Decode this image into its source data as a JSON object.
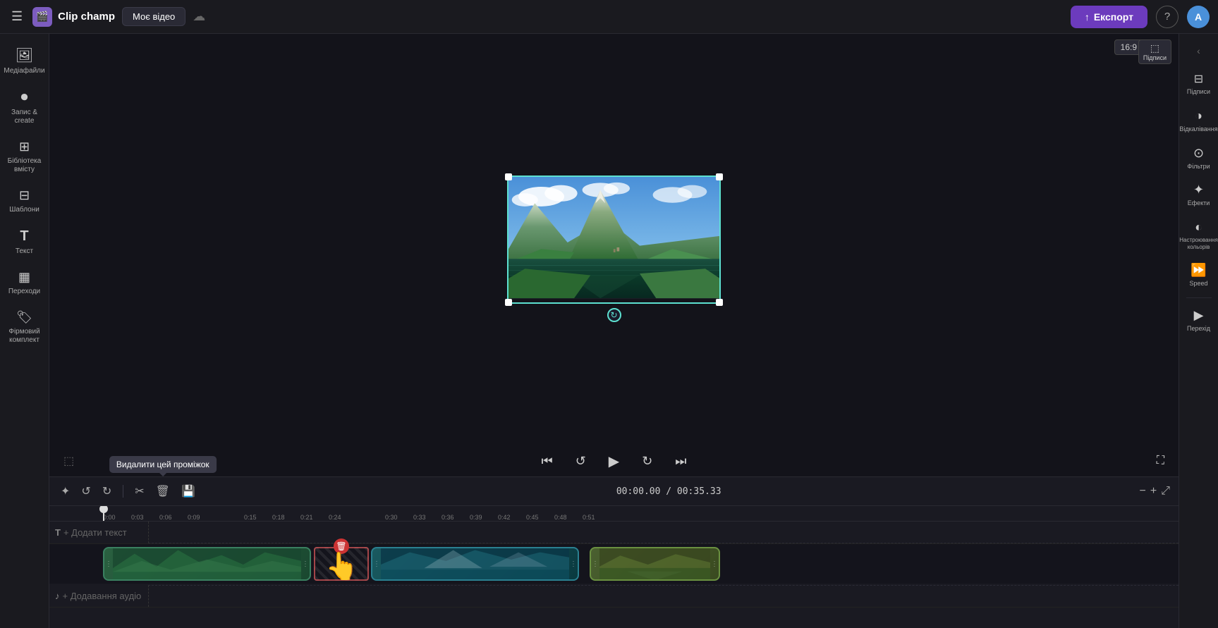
{
  "app": {
    "name": "Clip champ",
    "logo_icon": "🎬"
  },
  "topbar": {
    "menu_icon": "☰",
    "my_video_label": "Моє відео",
    "cloud_icon": "☁",
    "export_label": "Експорт",
    "export_icon": "↑",
    "help_icon": "?",
    "avatar_letter": "A"
  },
  "left_sidebar": {
    "items": [
      {
        "id": "media",
        "icon": "🖼",
        "label": "Медіафайли"
      },
      {
        "id": "record",
        "icon": "⏺",
        "label": "Запис &amp; create"
      },
      {
        "id": "library",
        "icon": "⊞",
        "label": "Бібліотека вмісту"
      },
      {
        "id": "templates",
        "icon": "⬜",
        "label": "Шаблони"
      },
      {
        "id": "text",
        "icon": "T",
        "label": "Текст"
      },
      {
        "id": "transitions",
        "icon": "▦",
        "label": "Переходи"
      },
      {
        "id": "brand",
        "icon": "🏷",
        "label": "Фірмовий комплект"
      }
    ]
  },
  "preview": {
    "aspect_ratio": "16:9",
    "captions_label": "Підписи"
  },
  "playback": {
    "skip_back_icon": "⏮",
    "rewind_icon": "↺",
    "play_icon": "▶",
    "forward_icon": "↻",
    "skip_forward_icon": "⏭",
    "subtitle_icon": "⬜",
    "fullscreen_icon": "⛶"
  },
  "timeline": {
    "toolbar": {
      "select_icon": "✦",
      "undo_icon": "↺",
      "redo_icon": "↻",
      "cut_icon": "✂",
      "delete_icon": "🗑",
      "save_icon": "💾"
    },
    "time_display": "00:00.00 / 00:35.33",
    "zoom_in_icon": "+",
    "zoom_out_icon": "−",
    "maximize_icon": "⤢",
    "ruler_marks": [
      "0:00",
      "0:03",
      "0:06",
      "0:09",
      "",
      "0:15",
      "0:18",
      "0:21",
      "0:24",
      "",
      "0:30",
      "0:33",
      "0:36",
      "0:39",
      "0:42",
      "0:45",
      "0:48",
      "0:51"
    ],
    "tracks": {
      "text_label": "T",
      "add_text_label": "+ Додати текст",
      "audio_label": "♪",
      "add_audio_label": "+ Додавання аудіо"
    },
    "tooltip": "Видалити цей проміжок",
    "clips": [
      {
        "id": "clip1",
        "type": "green",
        "start_pct": 0,
        "width_pct": 22,
        "label": "green1"
      },
      {
        "id": "gap1",
        "type": "gap",
        "start_pct": 22.5,
        "width_pct": 6,
        "label": "gap"
      },
      {
        "id": "clip2",
        "type": "cyan",
        "start_pct": 29.5,
        "width_pct": 18,
        "label": "cyan1"
      },
      {
        "id": "clip3",
        "type": "gold",
        "start_pct": 52,
        "width_pct": 12,
        "label": "gold1"
      }
    ]
  },
  "right_sidebar": {
    "items": [
      {
        "id": "captions",
        "icon": "⊟",
        "label": "Підписи"
      },
      {
        "id": "color_adjust",
        "icon": "◑",
        "label": "Відкалівання"
      },
      {
        "id": "filters",
        "icon": "⊙",
        "label": "Фільтри"
      },
      {
        "id": "effects",
        "icon": "✦",
        "label": "Ефекти"
      },
      {
        "id": "color_grading",
        "icon": "◐",
        "label": "Настроювання кольорів"
      },
      {
        "id": "speed",
        "icon": "⊙",
        "label": "Speed"
      },
      {
        "id": "transition",
        "icon": "▶",
        "label": "Перехід"
      }
    ]
  }
}
